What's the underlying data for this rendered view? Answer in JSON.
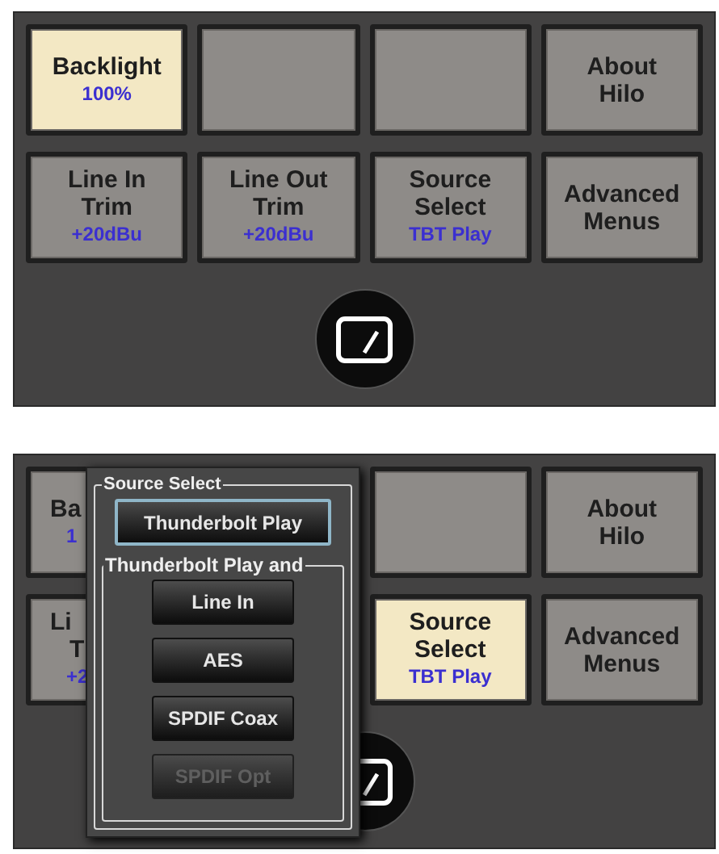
{
  "panels": [
    {
      "buttons": [
        {
          "kind": "full",
          "lines": [
            "Backlight"
          ],
          "value": "100%",
          "selected": true
        },
        {
          "kind": "full",
          "selected": false
        },
        {
          "kind": "full",
          "selected": false
        },
        {
          "kind": "full",
          "lines": [
            "About",
            "Hilo"
          ],
          "selected": false
        },
        {
          "kind": "full",
          "lines": [
            "Line In",
            "Trim"
          ],
          "value": "+20dBu",
          "selected": false
        },
        {
          "kind": "full",
          "lines": [
            "Line Out",
            "Trim"
          ],
          "value": "+20dBu",
          "selected": false
        },
        {
          "kind": "full",
          "lines": [
            "Source",
            "Select"
          ],
          "value": "TBT Play",
          "selected": false
        },
        {
          "kind": "full",
          "lines": [
            "Advanced",
            "Menus"
          ],
          "selected": false
        }
      ]
    },
    {
      "buttons": [
        {
          "kind": "cut",
          "lines": [
            "Ba"
          ],
          "value": "1",
          "selected": false
        },
        {
          "kind": "hidden"
        },
        {
          "kind": "full",
          "selected": false
        },
        {
          "kind": "full",
          "lines": [
            "About",
            "Hilo"
          ],
          "selected": false
        },
        {
          "kind": "cut",
          "lines": [
            "Li",
            "T"
          ],
          "value": "+2",
          "selected": false
        },
        {
          "kind": "hidden"
        },
        {
          "kind": "full",
          "lines": [
            "Source",
            "Select"
          ],
          "value": "TBT Play",
          "selected": true
        },
        {
          "kind": "full",
          "lines": [
            "Advanced",
            "Menus"
          ],
          "selected": false
        }
      ],
      "overlay": {
        "title": "Source Select",
        "primary": {
          "label": "Thunderbolt Play"
        },
        "group_title": "Thunderbolt Play and",
        "options": [
          {
            "label": "Line In",
            "disabled": false
          },
          {
            "label": "AES",
            "disabled": false
          },
          {
            "label": "SPDIF Coax",
            "disabled": false
          },
          {
            "label": "SPDIF Opt",
            "disabled": true
          }
        ]
      }
    }
  ]
}
